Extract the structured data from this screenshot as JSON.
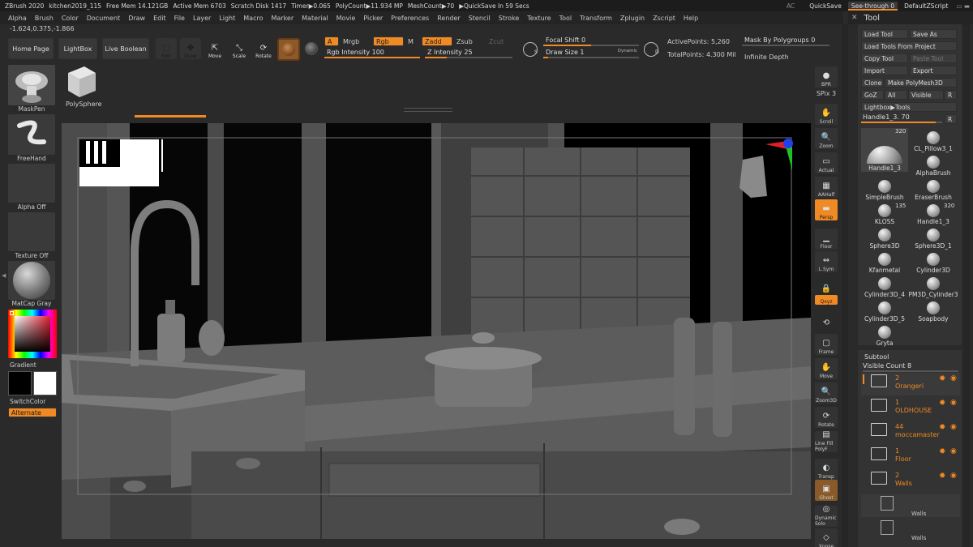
{
  "titlebar": {
    "app": "ZBrush 2020",
    "doc": "kitchen2019_115",
    "free_mem": "Free Mem 14.121GB",
    "active_mem": "Active Mem 6703",
    "scratch": "Scratch Disk 1417",
    "timer": "Timer▶0.065",
    "polycount": "PolyCount▶11.934 MP",
    "meshcount": "MeshCount▶70",
    "quicksave_in": "▶QuickSave In 59 Secs",
    "ac": "AC",
    "quicksave": "QuickSave",
    "seethrough": "See-through  0",
    "script": "DefaultZScript"
  },
  "menus": [
    "Alpha",
    "Brush",
    "Color",
    "Document",
    "Draw",
    "Edit",
    "File",
    "Layer",
    "Light",
    "Macro",
    "Marker",
    "Material",
    "Movie",
    "Picker",
    "Preferences",
    "Render",
    "Stencil",
    "Stroke",
    "Texture",
    "Tool",
    "Transform",
    "Zplugin",
    "Zscript",
    "Help"
  ],
  "coords": "-1.624,0.375,-1.866",
  "shelf": {
    "home_page": "Home Page",
    "lightbox": "LightBox",
    "live_boolean": "Live Boolean",
    "edit": "Edit",
    "draw": "Draw",
    "move": "Move",
    "scale": "Scale",
    "rotate": "Rotate",
    "a": "A",
    "mrgb": "Mrgb",
    "rgb": "Rgb",
    "m": "M",
    "zadd": "Zadd",
    "zsub": "Zsub",
    "zcut": "Zcut",
    "rgb_intensity": "Rgb Intensity 100",
    "z_intensity": "Z Intensity 25",
    "focal_shift": "Focal Shift 0",
    "draw_size": "Draw Size 1",
    "dynamic": "Dynamic",
    "active_points": "ActivePoints: 5,260",
    "total_points": "TotalPoints: 4.300 Mil",
    "mask_by_polygroups": "Mask By Polygroups 0",
    "infinite_depth": "Infinite Depth",
    "polysphere": "PolySphere"
  },
  "levels": {
    "rgb_intensity": 1.0,
    "z_intensity": 0.25,
    "focal_shift": 0.5,
    "draw_size": 0.05
  },
  "leftpanel": {
    "maskpen": "MaskPen",
    "freehand": "FreeHand",
    "alpha_off": "Alpha Off",
    "texture_off": "Texture Off",
    "matcap": "MatCap Gray",
    "gradient": "Gradient",
    "switchcolor": "SwitchColor",
    "alternate": "Alternate"
  },
  "righttoolbar": [
    "BPR",
    "SPix 3",
    "Scroll",
    "Zoom",
    "Actual",
    "AAHalf",
    "Persp",
    "Floor",
    "L.Sym",
    "",
    "Qxyz",
    "",
    "Frame",
    "Move",
    "Zoom3D",
    "Rotate",
    "Line Fill PolyF",
    "Transp",
    "Ghost",
    "Dynamic Solo",
    "Xpose"
  ],
  "toolpanel": {
    "title": "Tool",
    "load_tool": "Load Tool",
    "save_as": "Save As",
    "load_from_project": "Load Tools From Project",
    "copy_tool": "Copy Tool",
    "paste_tool": "Paste Tool",
    "import": "Import",
    "export": "Export",
    "clone": "Clone",
    "make_polymesh": "Make PolyMesh3D",
    "goz": "GoZ",
    "all": "All",
    "visible": "Visible",
    "r": "R",
    "lightbox_tools": "Lightbox▶Tools",
    "handle_slider": "Handle1_3. 70",
    "count_320": "320",
    "count_135": "135",
    "tools": [
      "Handle1_3",
      "CL_Pillow3_1",
      "",
      "AlphaBrush",
      "SimpleBrush",
      "EraserBrush",
      "KLOSS",
      "Handle1_3",
      "Sphere3D",
      "Sphere3D_1",
      "Kfanmetal",
      "Cylinder3D",
      "Cylinder3D_4",
      "PM3D_Cylinder3",
      "Cylinder3D_5",
      "Soapbody",
      "Gryta"
    ]
  },
  "subtool": {
    "title": "Subtool",
    "visible_count": "Visible Count 8",
    "items": [
      {
        "num": "2",
        "name": "Orangeri"
      },
      {
        "num": "1",
        "name": "OLDHOUSE"
      },
      {
        "num": "44",
        "name": "moccamaster"
      },
      {
        "num": "1",
        "name": "Floor"
      },
      {
        "num": "2",
        "name": "Walls"
      }
    ],
    "sub_walls_1": "Walls",
    "sub_walls_2": "Walls"
  },
  "colors": {
    "accent": "#f08a24",
    "panel": "#333333",
    "viewport": "#3f3f3f"
  }
}
